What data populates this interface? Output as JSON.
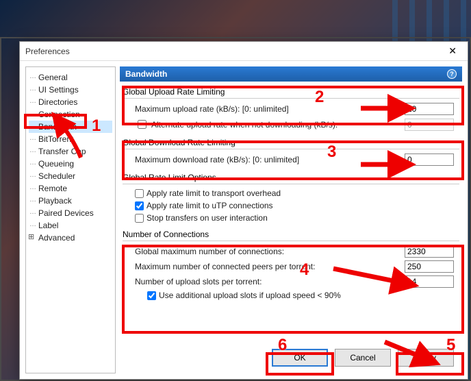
{
  "window": {
    "title": "Preferences"
  },
  "tree": {
    "items": [
      "General",
      "UI Settings",
      "Directories",
      "Connection",
      "Bandwidth",
      "BitTorrent",
      "Transfer Cap",
      "Queueing",
      "Scheduler",
      "Remote",
      "Playback",
      "Paired Devices",
      "Label",
      "Advanced"
    ],
    "selected_index": 4
  },
  "header": {
    "title": "Bandwidth"
  },
  "upload": {
    "group": "Global Upload Rate Limiting",
    "max_label": "Maximum upload rate (kB/s): [0: unlimited]",
    "max_value": "10",
    "alt_label": "Alternate upload rate when not downloading (kB/s):",
    "alt_checked": false,
    "alt_value": "0"
  },
  "download": {
    "group": "Global Download Rate Limiting",
    "max_label": "Maximum download rate (kB/s): [0: unlimited]",
    "max_value": "0"
  },
  "rate_options": {
    "group": "Global Rate Limit Options",
    "overhead_label": "Apply rate limit to transport overhead",
    "overhead_checked": false,
    "utp_label": "Apply rate limit to uTP connections",
    "utp_checked": true,
    "stop_label": "Stop transfers on user interaction",
    "stop_checked": false
  },
  "connections": {
    "group": "Number of Connections",
    "global_max_label": "Global maximum number of connections:",
    "global_max_value": "2330",
    "peers_label": "Maximum number of connected peers per torrent:",
    "peers_value": "250",
    "slots_label": "Number of upload slots per torrent:",
    "slots_value": "14",
    "additional_label": "Use additional upload slots if upload speed < 90%",
    "additional_checked": true
  },
  "buttons": {
    "ok": "OK",
    "cancel": "Cancel",
    "apply": "Apply"
  },
  "annotations": {
    "n1": "1",
    "n2": "2",
    "n3": "3",
    "n4": "4",
    "n5": "5",
    "n6": "6"
  }
}
